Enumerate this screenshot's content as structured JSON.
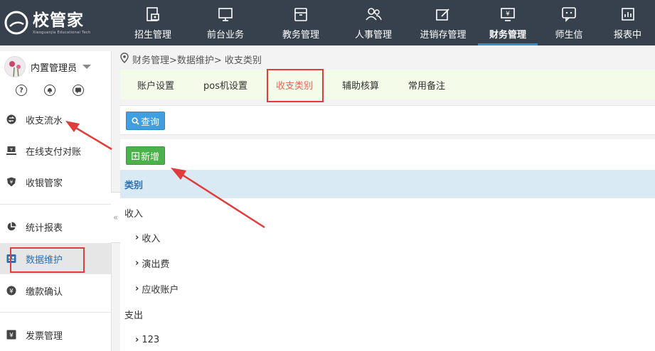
{
  "app": {
    "logo_title": "校管家",
    "logo_subtitle": "Xiaoguanjia Educational Tech"
  },
  "nav": {
    "items": [
      {
        "label": "招生管理",
        "icon": "enrollment-icon"
      },
      {
        "label": "前台业务",
        "icon": "monitor-icon"
      },
      {
        "label": "教务管理",
        "icon": "folder-icon"
      },
      {
        "label": "人事管理",
        "icon": "people-icon"
      },
      {
        "label": "进销存管理",
        "icon": "edit-icon"
      },
      {
        "label": "财务管理",
        "icon": "finance-icon"
      },
      {
        "label": "师生信",
        "icon": "message-icon"
      },
      {
        "label": "报表中",
        "icon": "report-icon"
      }
    ]
  },
  "sidebar": {
    "user_name": "内置管理员",
    "quick_icons": [
      "help-icon",
      "bell-icon",
      "chat-icon"
    ],
    "quick_glyphs": [
      "?",
      "🔔",
      "💬"
    ],
    "items": [
      {
        "label": "收支流水",
        "icon": "transfer-icon"
      },
      {
        "label": "在线支付对账",
        "icon": "pay-icon"
      },
      {
        "label": "收银管家",
        "icon": "shield-icon"
      },
      {
        "label": "统计报表",
        "icon": "pie-chart-icon"
      },
      {
        "label": "数据维护",
        "icon": "database-icon"
      },
      {
        "label": "缴款确认",
        "icon": "payment-icon"
      },
      {
        "label": "发票管理",
        "icon": "invoice-icon"
      }
    ],
    "collapse_glyph": "«"
  },
  "breadcrumb": "财务管理>数据维护> 收支类别",
  "tabs": [
    "账户设置",
    "pos机设置",
    "收支类别",
    "辅助核算",
    "常用备注"
  ],
  "toolbar": {
    "query_label": "查询",
    "add_label": "新增"
  },
  "table": {
    "header": "类别",
    "tree": [
      {
        "label": "收入",
        "level": 0
      },
      {
        "label": "收入",
        "level": 1
      },
      {
        "label": "演出费",
        "level": 1
      },
      {
        "label": "应收账户",
        "level": 1
      },
      {
        "label": "支出",
        "level": 0
      },
      {
        "label": "123",
        "level": 1
      }
    ]
  },
  "colors": {
    "topbar": "#36414d",
    "active_tab_text": "#e06a5a",
    "annotation_red": "#e23b3b",
    "query_button": "#3f9fe0",
    "add_button": "#4bb24b",
    "table_header_bg": "#d9eaf5"
  }
}
